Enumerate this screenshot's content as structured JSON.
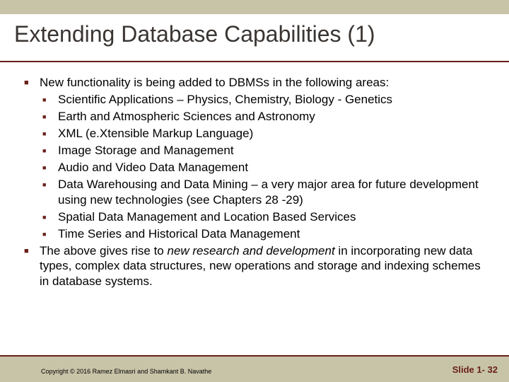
{
  "title": "Extending Database Capabilities (1)",
  "bullets": {
    "b1": "New functionality is being added to DBMSs in the following areas:",
    "sub": [
      "Scientific Applications – Physics, Chemistry, Biology - Genetics",
      "Earth and Atmospheric Sciences and Astronomy",
      "XML (e.Xtensible Markup Language)",
      "Image Storage and Management",
      "Audio and Video Data Management",
      "Data Warehousing and Data Mining – a very major area for future development using new technologies (see Chapters 28 -29)",
      "Spatial Data Management and Location Based Services",
      "Time Series and Historical Data Management"
    ],
    "b2_pre": "The above gives rise to ",
    "b2_em": "new research and development",
    "b2_post": " in incorporating new data types, complex data structures, new operations and storage and indexing schemes in database systems."
  },
  "footer": {
    "copyright": "Copyright © 2016 Ramez Elmasri and Shamkant B. Navathe",
    "slidenum": "Slide 1- 32"
  },
  "glyphs": {
    "square": "■"
  }
}
